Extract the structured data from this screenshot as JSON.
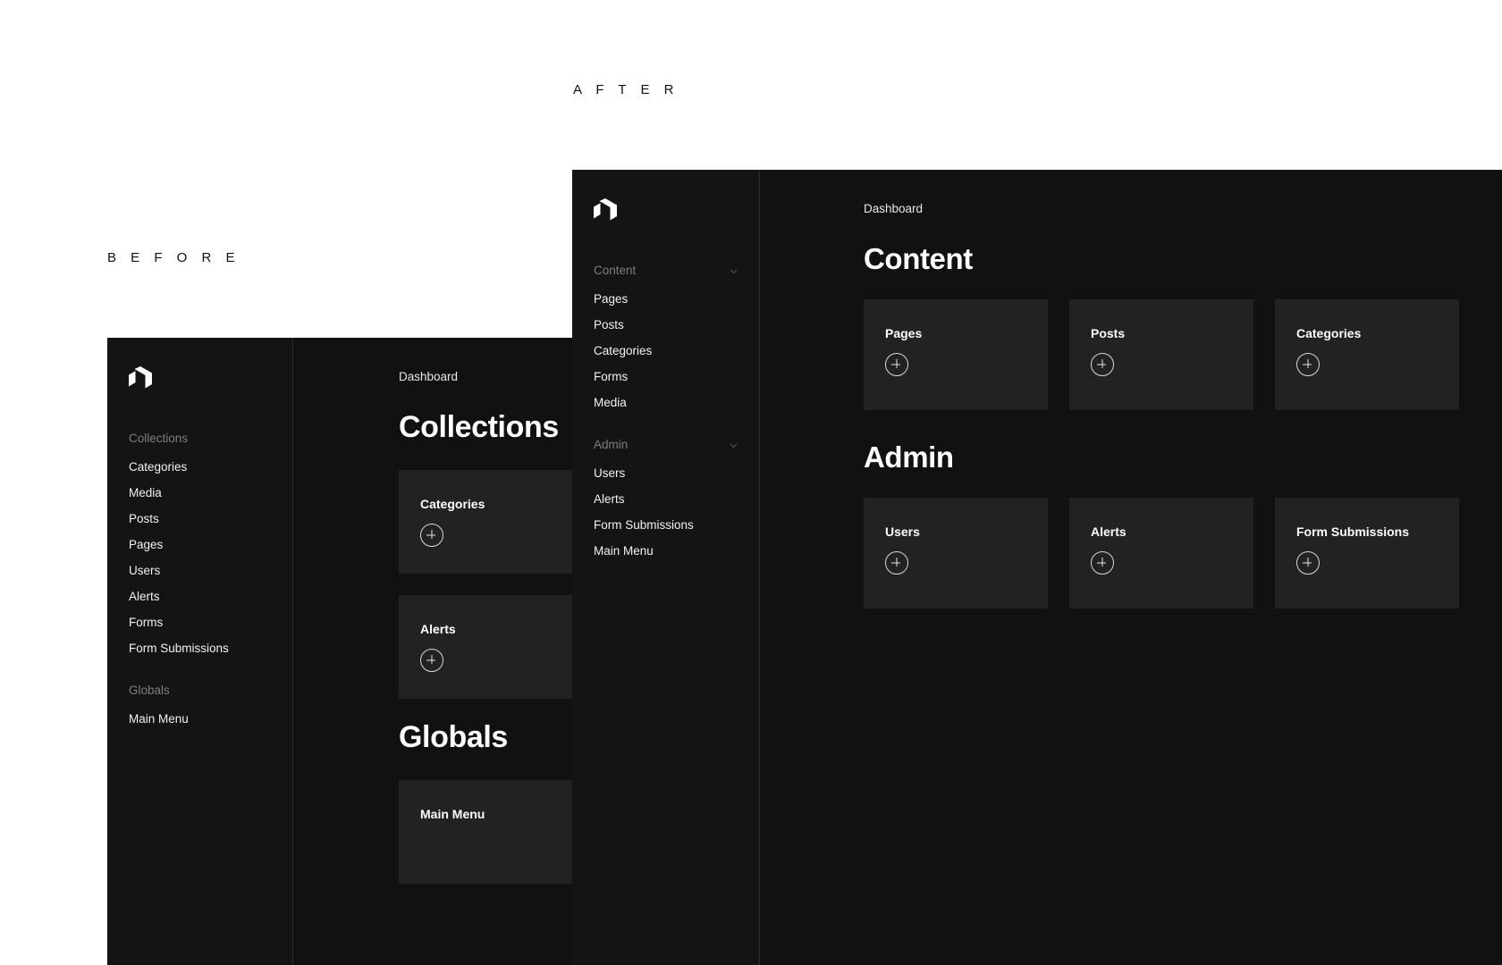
{
  "captions": {
    "after": "A F T E R",
    "before": "B E F O R E"
  },
  "colors": {
    "page_background": "#ffffff",
    "panel_background": "#111111",
    "sidebar_background": "#141414",
    "card_background": "#222222",
    "divider": "#2b2b2b",
    "text_primary": "#ffffff",
    "text_muted": "#7e7e7e"
  },
  "before": {
    "logo_name": "payload-logo",
    "sidebar": {
      "groups": [
        {
          "label": "Collections",
          "has_chevron": false,
          "items": [
            {
              "label": "Categories"
            },
            {
              "label": "Media"
            },
            {
              "label": "Posts"
            },
            {
              "label": "Pages"
            },
            {
              "label": "Users"
            },
            {
              "label": "Alerts"
            },
            {
              "label": "Forms"
            },
            {
              "label": "Form Submissions"
            }
          ]
        },
        {
          "label": "Globals",
          "has_chevron": false,
          "items": [
            {
              "label": "Main Menu"
            }
          ]
        }
      ]
    },
    "main": {
      "breadcrumb": "Dashboard",
      "sections": [
        {
          "title": "Collections",
          "cards": [
            {
              "title": "Categories",
              "action": "add"
            },
            {
              "title": "Alerts",
              "action": "add"
            }
          ]
        },
        {
          "title": "Globals",
          "cards": [
            {
              "title": "Main Menu",
              "action": "add"
            }
          ]
        }
      ]
    }
  },
  "after": {
    "logo_name": "payload-logo",
    "sidebar": {
      "groups": [
        {
          "label": "Content",
          "has_chevron": true,
          "items": [
            {
              "label": "Pages"
            },
            {
              "label": "Posts"
            },
            {
              "label": "Categories"
            },
            {
              "label": "Forms"
            },
            {
              "label": "Media"
            }
          ]
        },
        {
          "label": "Admin",
          "has_chevron": true,
          "items": [
            {
              "label": "Users"
            },
            {
              "label": "Alerts"
            },
            {
              "label": "Form Submissions"
            },
            {
              "label": "Main Menu"
            }
          ]
        }
      ]
    },
    "main": {
      "breadcrumb": "Dashboard",
      "sections": [
        {
          "title": "Content",
          "cards": [
            {
              "title": "Pages",
              "action": "add"
            },
            {
              "title": "Posts",
              "action": "add"
            },
            {
              "title": "Categories",
              "action": "add"
            }
          ]
        },
        {
          "title": "Admin",
          "cards": [
            {
              "title": "Users",
              "action": "add"
            },
            {
              "title": "Alerts",
              "action": "add"
            },
            {
              "title": "Form Submissions",
              "action": "add"
            }
          ]
        }
      ]
    }
  }
}
